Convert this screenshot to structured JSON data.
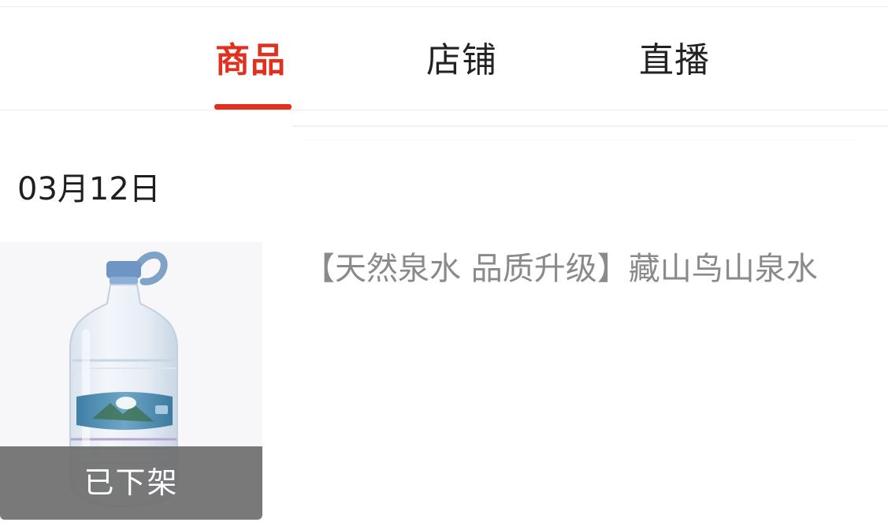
{
  "tabs": {
    "products": "商品",
    "shops": "店铺",
    "live": "直播",
    "active": "products",
    "accent_color": "#e0301e"
  },
  "date_header": "03月12日",
  "product": {
    "title": "【天然泉水 品质升级】藏山鸟山泉水",
    "status_badge": "已下架",
    "image_icon": "water-bottle-icon"
  }
}
